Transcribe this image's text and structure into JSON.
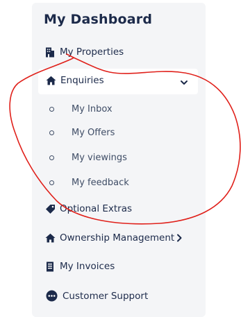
{
  "dashboard": {
    "title": "My Dashboard"
  },
  "nav": {
    "my_properties": "My Properties",
    "enquiries": "Enquiries",
    "enquiries_submenu": [
      "My Inbox",
      "My Offers",
      "My viewings",
      "My feedback"
    ],
    "optional_extras": "Optional Extras",
    "ownership_management": "Ownership Management",
    "my_invoices": "My Invoices",
    "customer_support": "Customer Support"
  },
  "colors": {
    "text_primary": "#1c2a4a",
    "panel_background": "#f4f5f7",
    "annotation_stroke": "#e0201a"
  },
  "icons": {
    "my_properties": "building-icon",
    "enquiries": "home-icon",
    "enquiries_toggle": "chevron-down-icon",
    "optional_extras": "tag-icon",
    "ownership_management": "home-icon",
    "ownership_toggle": "chevron-right-icon",
    "my_invoices": "receipt-icon",
    "customer_support": "chat-bubble-icon"
  }
}
